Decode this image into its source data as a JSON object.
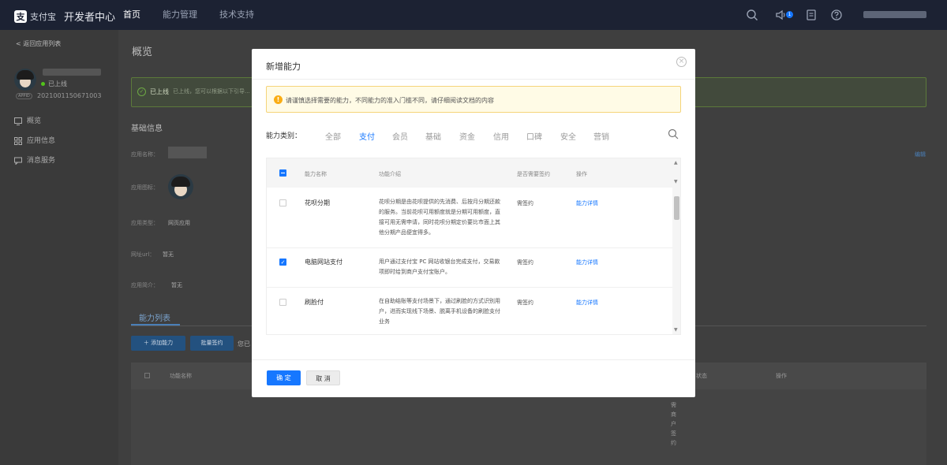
{
  "topbar": {
    "brand_mark": "支",
    "brand_name": "支付宝",
    "title": "开发者中心",
    "nav": [
      {
        "label": "首页",
        "active": true
      },
      {
        "label": "能力管理",
        "active": false
      },
      {
        "label": "技术支持",
        "active": false
      }
    ],
    "notification_count": "1",
    "icons": {
      "search": "search-icon",
      "notice": "speaker-icon",
      "help": "help-icon",
      "user": "user-icon"
    }
  },
  "sidebar": {
    "back_label": "< 返回应用列表",
    "status": "已上线",
    "app_id_tag": "APPID",
    "app_id": "2021001150671003",
    "menu": [
      {
        "label": "概览",
        "icon": "chart-icon"
      },
      {
        "label": "应用信息",
        "icon": "grid-icon"
      },
      {
        "label": "消息服务",
        "icon": "message-icon"
      }
    ]
  },
  "page": {
    "title": "概览",
    "alert_status": "已上线",
    "alert_text": "已上线，您可以根据以下引导...",
    "section_title": "基础信息",
    "fields": [
      {
        "label": "应用名称：",
        "value": ""
      },
      {
        "label": "应用图标：",
        "value": ""
      },
      {
        "label": "应用类型：",
        "value": "网页应用"
      },
      {
        "label": "网址url：",
        "value": "暂无"
      },
      {
        "label": "应用简介：",
        "value": "暂无"
      }
    ],
    "edit_label": "编辑",
    "tab_label": "能力列表",
    "add_button": "＋ 添加能力",
    "batch_button": "批量签约",
    "tail_text": "您已",
    "table_headers": {
      "name": "功能名称",
      "status": "状态",
      "action": "操作"
    },
    "vertical_text": "需商户签约"
  },
  "modal": {
    "title": "新增能力",
    "notice": "请谨慎选择需要的能力，不同能力的准入门槛不同，请仔细阅读文档的内容",
    "category_label": "能力类别：",
    "categories": [
      {
        "label": "全部",
        "active": false
      },
      {
        "label": "支付",
        "active": true
      },
      {
        "label": "会员",
        "active": false
      },
      {
        "label": "基础",
        "active": false
      },
      {
        "label": "资金",
        "active": false
      },
      {
        "label": "信用",
        "active": false
      },
      {
        "label": "口碑",
        "active": false
      },
      {
        "label": "安全",
        "active": false
      },
      {
        "label": "营销",
        "active": false
      }
    ],
    "columns": {
      "name": "能力名称",
      "desc": "功能介绍",
      "sign": "是否需要签约",
      "action": "操作"
    },
    "rows": [
      {
        "name": "花呗分期",
        "desc": "花呗分期是由花呗提供的先消费、后按月分期还款的服务。当前花呗可用额度就是分期可用额度，直接可用无需申请，同时花呗分期定价要比市面上其他分期产品便宜得多。",
        "sign": "需签约",
        "action": "能力详情",
        "checked": false
      },
      {
        "name": "电脑网站支付",
        "desc": "用户通过支付宝 PC 网站收银台完成支付，交易款项即时给到商户支付宝账户。",
        "sign": "需签约",
        "action": "能力详情",
        "checked": true
      },
      {
        "name": "刷脸付",
        "desc": "在自助结账等支付场景下，通过刷脸的方式识别用户，进而实现线下场景、脱离手机设备的刷脸支付业务",
        "sign": "需签约",
        "action": "能力详情",
        "checked": false
      }
    ],
    "confirm_label": "确 定",
    "cancel_label": "取 消"
  },
  "colors": {
    "primary": "#1677ff",
    "topbar": "#1c2233",
    "warning": "#faad14",
    "success": "#52c41a"
  }
}
